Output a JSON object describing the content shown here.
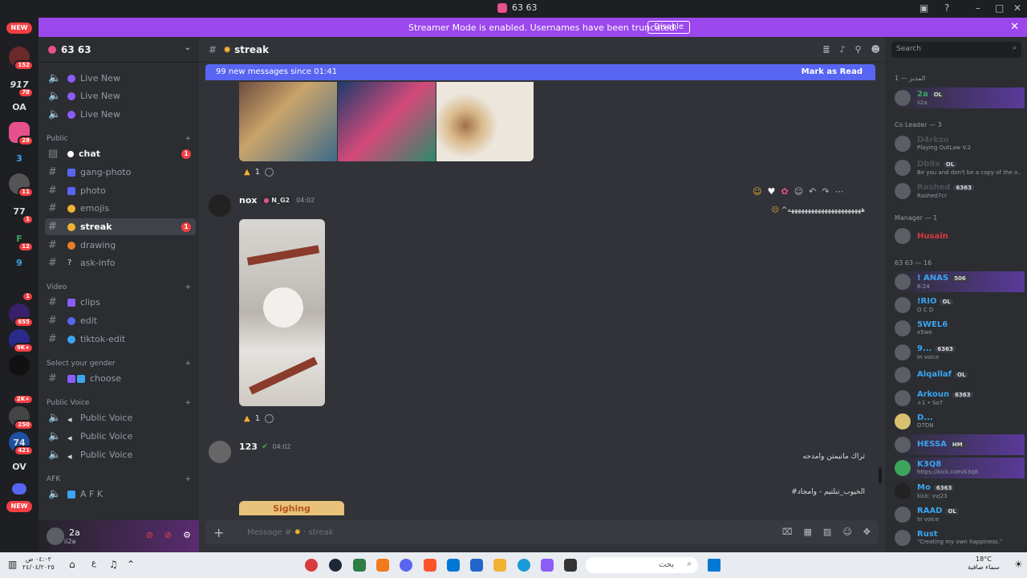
{
  "window": {
    "title": "63 63"
  },
  "banner": {
    "text": "Streamer Mode is enabled. Usernames have been truncated.",
    "button": "Disable"
  },
  "servers": {
    "new_label": "NEW",
    "items": [
      {
        "label": "",
        "badge": "152"
      },
      {
        "label": "917",
        "badge": "78"
      },
      {
        "label": "OA",
        "badge": ""
      },
      {
        "label": "",
        "badge": "28"
      },
      {
        "label": "3",
        "badge": ""
      },
      {
        "label": "",
        "badge": "11"
      },
      {
        "label": "77",
        "badge": "1"
      },
      {
        "label": "F",
        "badge": "12"
      },
      {
        "label": "9",
        "badge": ""
      },
      {
        "label": "",
        "badge": "1"
      },
      {
        "label": "",
        "badge": "655"
      },
      {
        "label": "",
        "badge": "9K+"
      },
      {
        "label": "",
        "badge": ""
      },
      {
        "label": "",
        "badge": "2K+"
      },
      {
        "label": "",
        "badge": "250"
      },
      {
        "label": "74",
        "badge": "421"
      },
      {
        "label": "OV",
        "badge": ""
      }
    ]
  },
  "guild": {
    "name": "63 63"
  },
  "channels": {
    "live": [
      {
        "label": "Live New"
      },
      {
        "label": "Live New"
      },
      {
        "label": "Live New"
      }
    ],
    "cat_public": "Public",
    "public": [
      {
        "label": "chat",
        "unread": "1"
      },
      {
        "label": "gang-photo",
        "unread": ""
      },
      {
        "label": "photo",
        "unread": ""
      },
      {
        "label": "emojis",
        "unread": ""
      },
      {
        "label": "streak",
        "unread": "1"
      },
      {
        "label": "drawing",
        "unread": ""
      },
      {
        "label": "ask-info",
        "unread": ""
      }
    ],
    "cat_video": "Video",
    "video": [
      {
        "label": "clips"
      },
      {
        "label": "edit"
      },
      {
        "label": "tiktok-edit"
      }
    ],
    "cat_gender": "Select your gender",
    "gender": [
      {
        "label": "choose"
      }
    ],
    "cat_public_voice": "Public Voice",
    "public_voice": [
      {
        "label": "Public Voice"
      },
      {
        "label": "Public Voice"
      },
      {
        "label": "Public Voice"
      }
    ],
    "cat_afk": "AFK",
    "afk": [
      {
        "label": "A F K"
      }
    ]
  },
  "user": {
    "name": "2a",
    "status": "ii2a"
  },
  "channel_header": {
    "name": "streak"
  },
  "new_messages": {
    "text": "99 new messages since 01:41",
    "action": "Mark as Read"
  },
  "messages": [
    {
      "reaction_count": "1"
    },
    {
      "author": "nox",
      "tag": "N_G2",
      "time": "04:02",
      "text": "^ههههههههههههههههههههههه",
      "reaction_count": "1"
    },
    {
      "author": "123",
      "time": "04:02",
      "line1": "ثراك ماتيمتن وامدحه",
      "line2": "#الخيوب_تبلتيم - وامجاد",
      "image_text": "Sighing"
    }
  ],
  "composer": {
    "placeholder": "Message #",
    "channel": "streak"
  },
  "members": {
    "search_placeholder": "Search",
    "groups": [
      {
        "title": "المدير — 1",
        "members": [
          {
            "name": "2a",
            "tag": "OL",
            "status": "ii2a",
            "color": "#3ba55c"
          }
        ]
      },
      {
        "title": "Co Leader — 3",
        "members": [
          {
            "name": "D4rkzo",
            "tag": "",
            "status": "Playing OutLaw V.2",
            "color": "#4e5058"
          },
          {
            "name": "Db9x",
            "tag": "OL",
            "status": "Be you and don't be a copy of the o...",
            "color": "#4e5058"
          },
          {
            "name": "Rashed",
            "tag": "6363",
            "status": "Rashed7cr",
            "color": "#4e5058"
          }
        ]
      },
      {
        "title": "Manager — 1",
        "members": [
          {
            "name": "Husain",
            "tag": "",
            "status": "",
            "color": "#d83c3e"
          }
        ]
      },
      {
        "title": "63 63 — 16",
        "members": [
          {
            "name": "! ANAS",
            "tag": "506",
            "status": "8:24",
            "color": "#3ba5f0"
          },
          {
            "name": "!RIO",
            "tag": "OL",
            "status": "O C D",
            "color": "#3ba5f0"
          },
          {
            "name": "5WEL6",
            "tag": "",
            "status": "x5we",
            "color": "#3ba5f0"
          },
          {
            "name": "9...",
            "tag": "6363",
            "status": "In voice",
            "color": "#3ba5f0"
          },
          {
            "name": "Alqallaf",
            "tag": "OL",
            "status": "",
            "color": "#3ba5f0"
          },
          {
            "name": "Arkoun",
            "tag": "6363",
            "status": "+1 • So7",
            "color": "#3ba5f0"
          },
          {
            "name": "D...",
            "tag": "",
            "status": "D7DN",
            "color": "#3ba5f0"
          },
          {
            "name": "HESSA",
            "tag": "HM",
            "status": "",
            "color": "#3ba5f0"
          },
          {
            "name": "K3Q8",
            "tag": "",
            "status": "https://kick.com/k3q8",
            "color": "#3ba5f0"
          },
          {
            "name": "Mo",
            "tag": "6363",
            "status": "kick: vvj23",
            "color": "#3ba5f0"
          },
          {
            "name": "RAAD",
            "tag": "OL",
            "status": "In voice",
            "color": "#3ba5f0"
          },
          {
            "name": "Rust",
            "tag": "",
            "status": "\"Creating my own happiness.\"",
            "color": "#3ba5f0"
          }
        ]
      }
    ]
  },
  "taskbar": {
    "time": "٠٤:٠٢ ص",
    "date": "٢٤/٠٤/٢٠٢٥",
    "lang": "ع",
    "search": "بحث",
    "temp": "18°C",
    "weather": "سماء صافية"
  }
}
